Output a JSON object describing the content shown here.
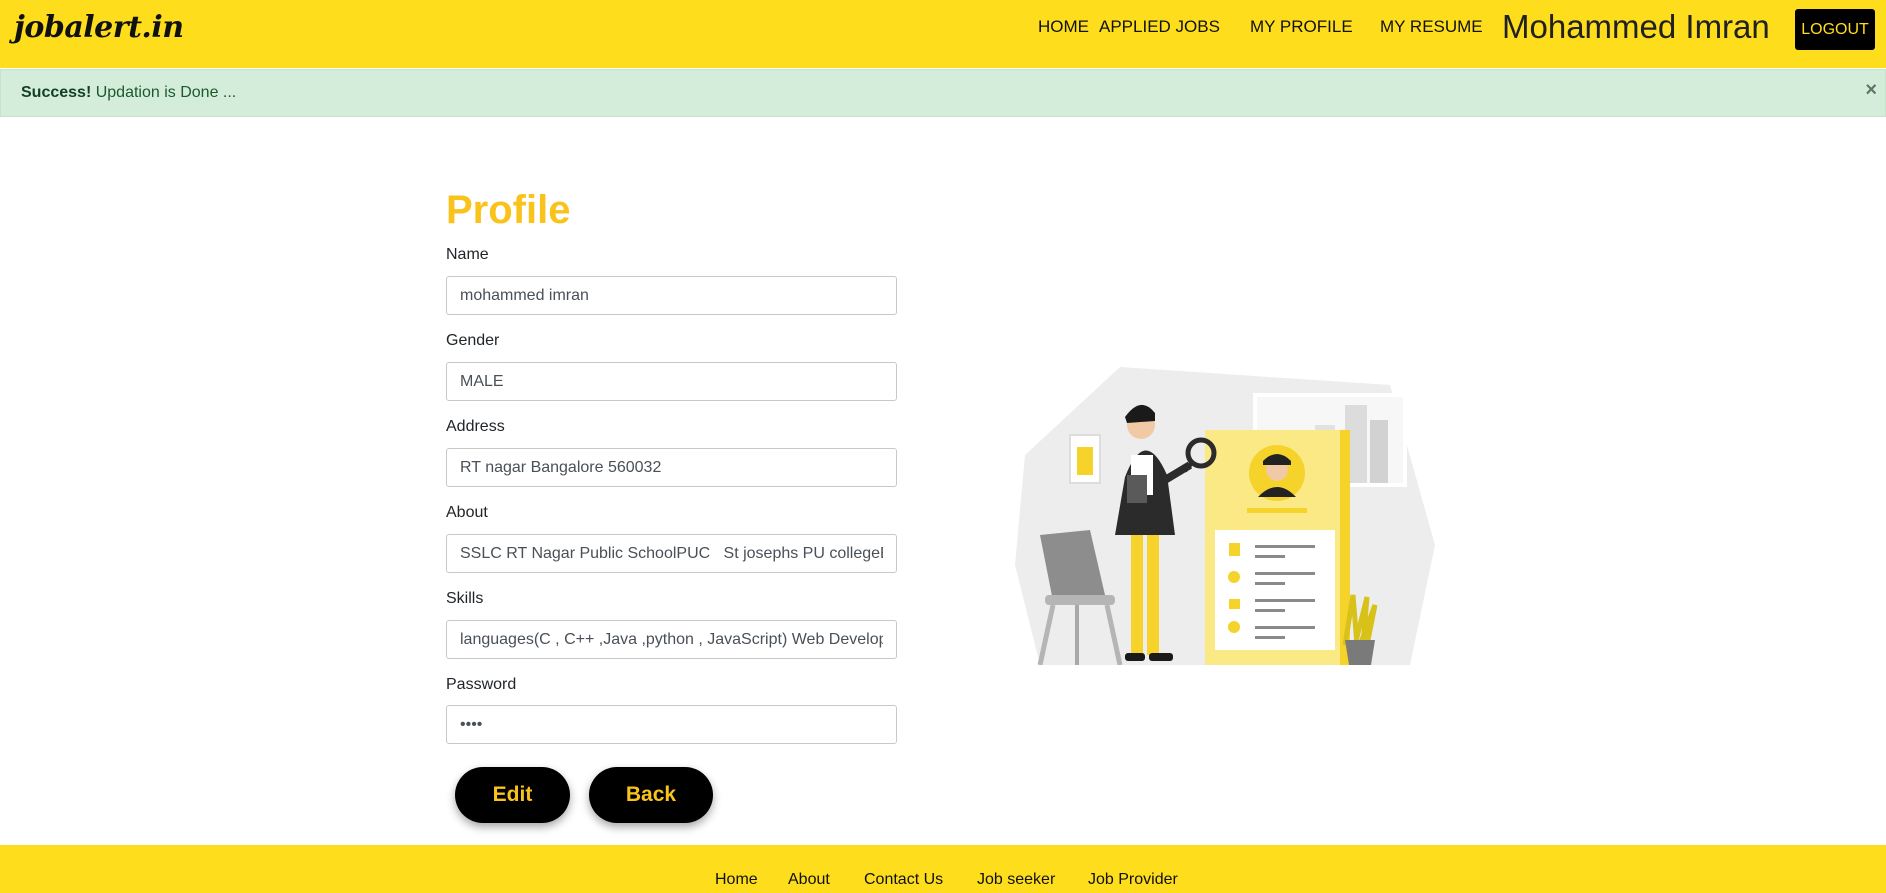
{
  "header": {
    "logo": "jobalert.in",
    "nav": [
      "HOME",
      "APPLIED JOBS",
      "MY PROFILE",
      "MY RESUME"
    ],
    "username": "Mohammed Imran",
    "logout_label": "LOGOUT"
  },
  "alert": {
    "strong": "Success!",
    "message": "Updation is Done ...",
    "close_icon": "×"
  },
  "profile": {
    "title": "Profile",
    "fields": {
      "name": {
        "label": "Name",
        "value": "mohammed imran"
      },
      "gender": {
        "label": "Gender",
        "value": "MALE"
      },
      "address": {
        "label": "Address",
        "value": "RT nagar Bangalore 560032"
      },
      "about": {
        "label": "About",
        "value": "SSLC RT Nagar Public SchoolPUC   St josephs PU collegeBE"
      },
      "skills": {
        "label": "Skills",
        "value": "languages(C , C++ ,Java ,python , JavaScript) Web Development"
      },
      "password": {
        "label": "Password",
        "value": "••••"
      }
    },
    "edit_label": "Edit",
    "back_label": "Back"
  },
  "footer": {
    "links": [
      "Home",
      "About",
      "Contact Us",
      "Job seeker",
      "Job Provider"
    ]
  },
  "colors": {
    "brand_yellow": "#fedd1d",
    "accent_yellow": "#f9c31c",
    "alert_bg": "#d4eddb",
    "button_black": "#000000"
  },
  "icons": {
    "close": "close-icon",
    "illustration": "profile-illustration"
  }
}
